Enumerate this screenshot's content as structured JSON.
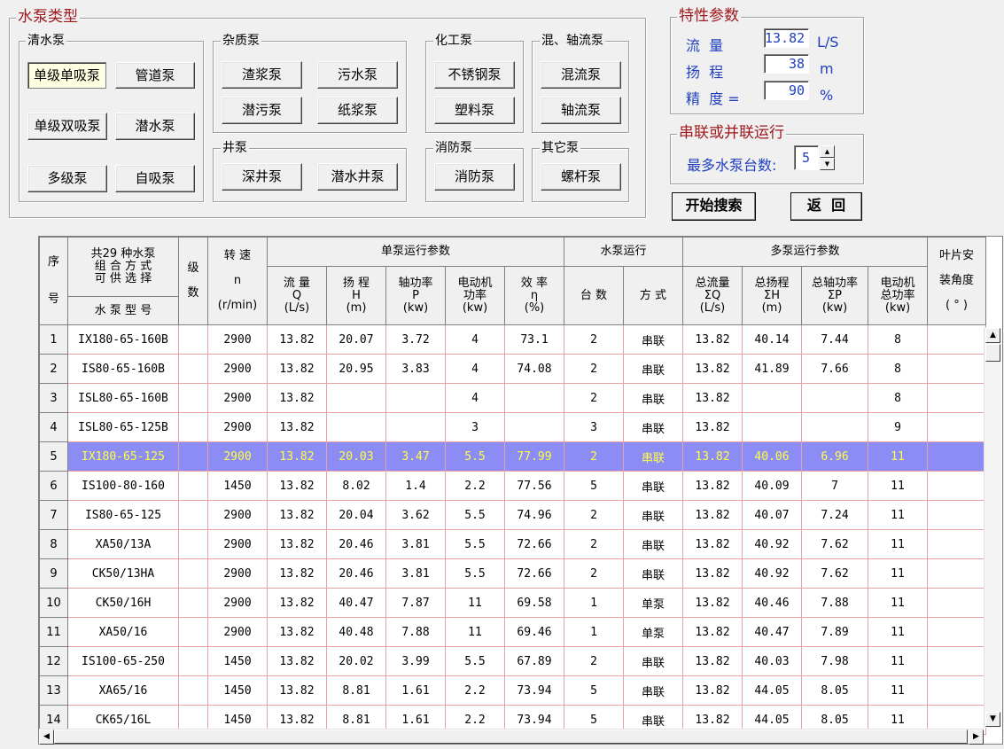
{
  "pump_types": {
    "title": "水泵类型",
    "groups": {
      "clear": {
        "title": "清水泵",
        "buttons": [
          "单级单吸泵",
          "管道泵",
          "单级双吸泵",
          "潜水泵",
          "多级泵",
          "自吸泵"
        ]
      },
      "impurity": {
        "title": "杂质泵",
        "buttons": [
          "渣浆泵",
          "污水泵",
          "潜污泵",
          "纸浆泵"
        ]
      },
      "chemical": {
        "title": "化工泵",
        "buttons": [
          "不锈钢泵",
          "塑料泵"
        ]
      },
      "mixed": {
        "title": "混、轴流泵",
        "buttons": [
          "混流泵",
          "轴流泵"
        ]
      },
      "well": {
        "title": "井泵",
        "buttons": [
          "深井泵",
          "潜水井泵"
        ]
      },
      "fire": {
        "title": "消防泵",
        "buttons": [
          "消防泵"
        ]
      },
      "other": {
        "title": "其它泵",
        "buttons": [
          "螺杆泵"
        ]
      }
    }
  },
  "characteristics": {
    "title": "特性参数",
    "flow": {
      "label": "流  量",
      "value": "13.82",
      "unit": "L/S"
    },
    "head": {
      "label": "扬  程",
      "value": "38",
      "unit": "m"
    },
    "precision": {
      "label": "精  度 =",
      "value": "90",
      "unit": "%"
    }
  },
  "series_parallel": {
    "title": "串联或并联运行",
    "max_label": "最多水泵台数:",
    "max_value": "5"
  },
  "actions": {
    "search": "开始搜索",
    "back": "返  回"
  },
  "grid": {
    "headers": {
      "seq": [
        "序",
        "号"
      ],
      "model_top": [
        "共29 种水泵",
        "组 合 方 式",
        "可 供 选 择"
      ],
      "model": "水 泵 型 号",
      "stage": [
        "级",
        "数"
      ],
      "speed": [
        "转  速",
        "n",
        "(r/min)"
      ],
      "single": "单泵运行参数",
      "single_cols": [
        [
          "流  量",
          "Q",
          "(L/s)"
        ],
        [
          "扬  程",
          "H",
          "(m)"
        ],
        [
          "轴功率",
          "P",
          "(kw)"
        ],
        [
          "电动机",
          "功率",
          "(kw)"
        ],
        [
          "效  率",
          "η",
          "(%)"
        ]
      ],
      "operation": "水泵运行",
      "op_cols": [
        "台  数",
        "方  式"
      ],
      "multi": "多泵运行参数",
      "multi_cols": [
        [
          "总流量",
          "ΣQ",
          "(L/s)"
        ],
        [
          "总扬程",
          "ΣH",
          "(m)"
        ],
        [
          "总轴功率",
          "ΣP",
          "(kw)"
        ],
        [
          "电动机",
          "总功率",
          "(kw)"
        ]
      ],
      "blade": [
        "叶片安",
        "装角度",
        "( ° )"
      ]
    },
    "rows": [
      [
        "1",
        "IX180-65-160B",
        "",
        "2900",
        "13.82",
        "20.07",
        "3.72",
        "4",
        "73.1",
        "2",
        "串联",
        "13.82",
        "40.14",
        "7.44",
        "8",
        ""
      ],
      [
        "2",
        "IS80-65-160B",
        "",
        "2900",
        "13.82",
        "20.95",
        "3.83",
        "4",
        "74.08",
        "2",
        "串联",
        "13.82",
        "41.89",
        "7.66",
        "8",
        ""
      ],
      [
        "3",
        "ISL80-65-160B",
        "",
        "2900",
        "13.82",
        "",
        "",
        "4",
        "",
        "2",
        "串联",
        "13.82",
        "",
        "",
        "8",
        ""
      ],
      [
        "4",
        "ISL80-65-125B",
        "",
        "2900",
        "13.82",
        "",
        "",
        "3",
        "",
        "3",
        "串联",
        "13.82",
        "",
        "",
        "9",
        ""
      ],
      [
        "5",
        "IX180-65-125",
        "",
        "2900",
        "13.82",
        "20.03",
        "3.47",
        "5.5",
        "77.99",
        "2",
        "串联",
        "13.82",
        "40.06",
        "6.96",
        "11",
        ""
      ],
      [
        "6",
        "IS100-80-160",
        "",
        "1450",
        "13.82",
        "8.02",
        "1.4",
        "2.2",
        "77.56",
        "5",
        "串联",
        "13.82",
        "40.09",
        "7",
        "11",
        ""
      ],
      [
        "7",
        "IS80-65-125",
        "",
        "2900",
        "13.82",
        "20.04",
        "3.62",
        "5.5",
        "74.96",
        "2",
        "串联",
        "13.82",
        "40.07",
        "7.24",
        "11",
        ""
      ],
      [
        "8",
        "XA50/13A",
        "",
        "2900",
        "13.82",
        "20.46",
        "3.81",
        "5.5",
        "72.66",
        "2",
        "串联",
        "13.82",
        "40.92",
        "7.62",
        "11",
        ""
      ],
      [
        "9",
        "CK50/13HA",
        "",
        "2900",
        "13.82",
        "20.46",
        "3.81",
        "5.5",
        "72.66",
        "2",
        "串联",
        "13.82",
        "40.92",
        "7.62",
        "11",
        ""
      ],
      [
        "10",
        "CK50/16H",
        "",
        "2900",
        "13.82",
        "40.47",
        "7.87",
        "11",
        "69.58",
        "1",
        "单泵",
        "13.82",
        "40.46",
        "7.88",
        "11",
        ""
      ],
      [
        "11",
        "XA50/16",
        "",
        "2900",
        "13.82",
        "40.48",
        "7.88",
        "11",
        "69.46",
        "1",
        "单泵",
        "13.82",
        "40.47",
        "7.89",
        "11",
        ""
      ],
      [
        "12",
        "IS100-65-250",
        "",
        "1450",
        "13.82",
        "20.02",
        "3.99",
        "5.5",
        "67.89",
        "2",
        "串联",
        "13.82",
        "40.03",
        "7.98",
        "11",
        ""
      ],
      [
        "13",
        "XA65/16",
        "",
        "1450",
        "13.82",
        "8.81",
        "1.61",
        "2.2",
        "73.94",
        "5",
        "串联",
        "13.82",
        "44.05",
        "8.05",
        "11",
        ""
      ],
      [
        "14",
        "CK65/16L",
        "",
        "1450",
        "13.82",
        "8.81",
        "1.61",
        "2.2",
        "73.94",
        "5",
        "串联",
        "13.82",
        "44.05",
        "8.05",
        "11",
        ""
      ]
    ],
    "selected_row": 5
  },
  "colors": {
    "highlight_bg": "#8c8cf5",
    "highlight_text": "#ffff40",
    "label_blue": "#2040c0",
    "title_red": "#a0191e"
  }
}
